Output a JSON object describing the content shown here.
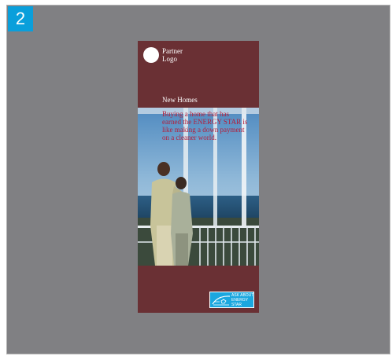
{
  "step_number": "2",
  "brochure": {
    "logo": {
      "line1": "Partner",
      "line2": "Logo"
    },
    "section_title": "New Homes",
    "tagline": [
      "Buying a home that has",
      "earned the ENERGY STAR is",
      "like making a down payment",
      "on a cleaner world."
    ],
    "badge": {
      "line1": "ASK ABOUT",
      "line2": "ENERGY",
      "line3": "STAR",
      "icon": "energy-star-logo"
    }
  },
  "colors": {
    "canvas": "#808083",
    "step_badge": "#0a9fdb",
    "brochure_bg": "#6a3034",
    "tagline": "#b31e3a",
    "energy_star_blue": "#1ba7df"
  }
}
